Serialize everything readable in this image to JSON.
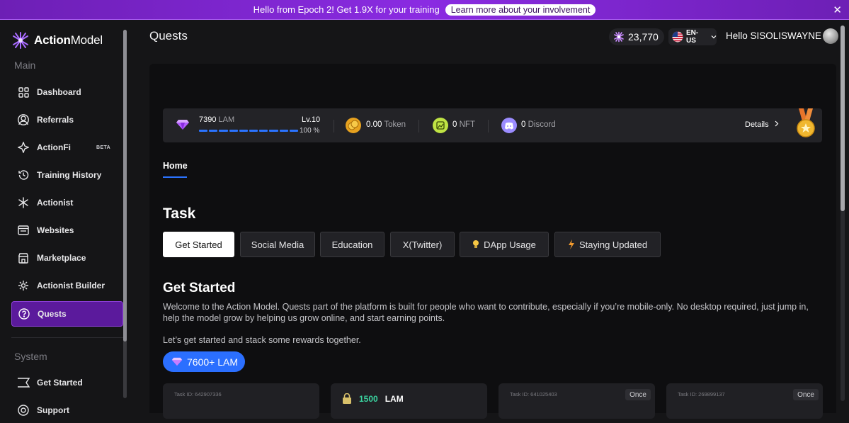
{
  "banner": {
    "message": "Hello from Epoch 2! Get 1.9X for your training",
    "link_label": "Learn more about your involvement",
    "close_glyph": "✕"
  },
  "sidebar": {
    "logo_text_bold": "Action",
    "logo_text_thin": "Model",
    "section_main": "Main",
    "items": [
      {
        "label": "Dashboard",
        "icon": "grid-icon"
      },
      {
        "label": "Referrals",
        "icon": "referrals-icon"
      },
      {
        "label": "ActionFi",
        "icon": "actionfi-icon",
        "badge": "BETA"
      },
      {
        "label": "Training History",
        "icon": "history-icon"
      },
      {
        "label": "Actionist",
        "icon": "actionist-icon"
      },
      {
        "label": "Websites",
        "icon": "websites-icon"
      },
      {
        "label": "Marketplace",
        "icon": "marketplace-icon"
      },
      {
        "label": "Actionist Builder",
        "icon": "builder-icon"
      },
      {
        "label": "Quests",
        "icon": "quests-icon",
        "active": true
      }
    ],
    "section_system": "System",
    "system_items": [
      {
        "label": "Get Started",
        "icon": "get-started-icon"
      },
      {
        "label": "Support",
        "icon": "support-icon"
      }
    ]
  },
  "header": {
    "title": "Quests",
    "points": "23,770",
    "language": "EN-US",
    "greeting": "Hello SISOLISWAYNE"
  },
  "stats": {
    "lam_value": "7390",
    "lam_unit": "LAM",
    "level": "Lv.10",
    "progress_percent": "100 %",
    "progress_fraction": 1.0,
    "token_value": "0.00",
    "token_unit": "Token",
    "nft_value": "0",
    "nft_unit": "NFT",
    "discord_value": "0",
    "discord_unit": "Discord",
    "details_label": "Details"
  },
  "tabs": {
    "home": "Home"
  },
  "task": {
    "heading": "Task",
    "categories": [
      {
        "label": "Get Started",
        "selected": true
      },
      {
        "label": "Social Media"
      },
      {
        "label": "Education"
      },
      {
        "label": "X(Twitter)"
      },
      {
        "label": "DApp Usage",
        "icon": "bulb-icon"
      },
      {
        "label": "Staying Updated",
        "icon": "bolt-icon"
      }
    ]
  },
  "get_started": {
    "heading": "Get Started",
    "description": "Welcome to the Action Model. Quests part of the platform is built for people who want to contribute, especially if you’re mobile-only. No desktop required, just jump in, help the model grow by helping us grow online, and start earning points.",
    "cta_text": "Let’s get started and stack some rewards together.",
    "reward": "7600+ LAM"
  },
  "cards": [
    {
      "task_id": "Task ID: 642907336",
      "once": ""
    },
    {
      "task_id": "",
      "locked_amount": "1500",
      "locked_unit": "LAM"
    },
    {
      "task_id": "Task ID: 641025403",
      "once": "Once"
    },
    {
      "task_id": "Task ID: 269899137",
      "once": "Once"
    }
  ],
  "colors": {
    "accent_purple": "#6d1fb5",
    "active_nav": "#5b1a9c",
    "accent_blue": "#2b73ff",
    "green": "#3ad29f"
  }
}
